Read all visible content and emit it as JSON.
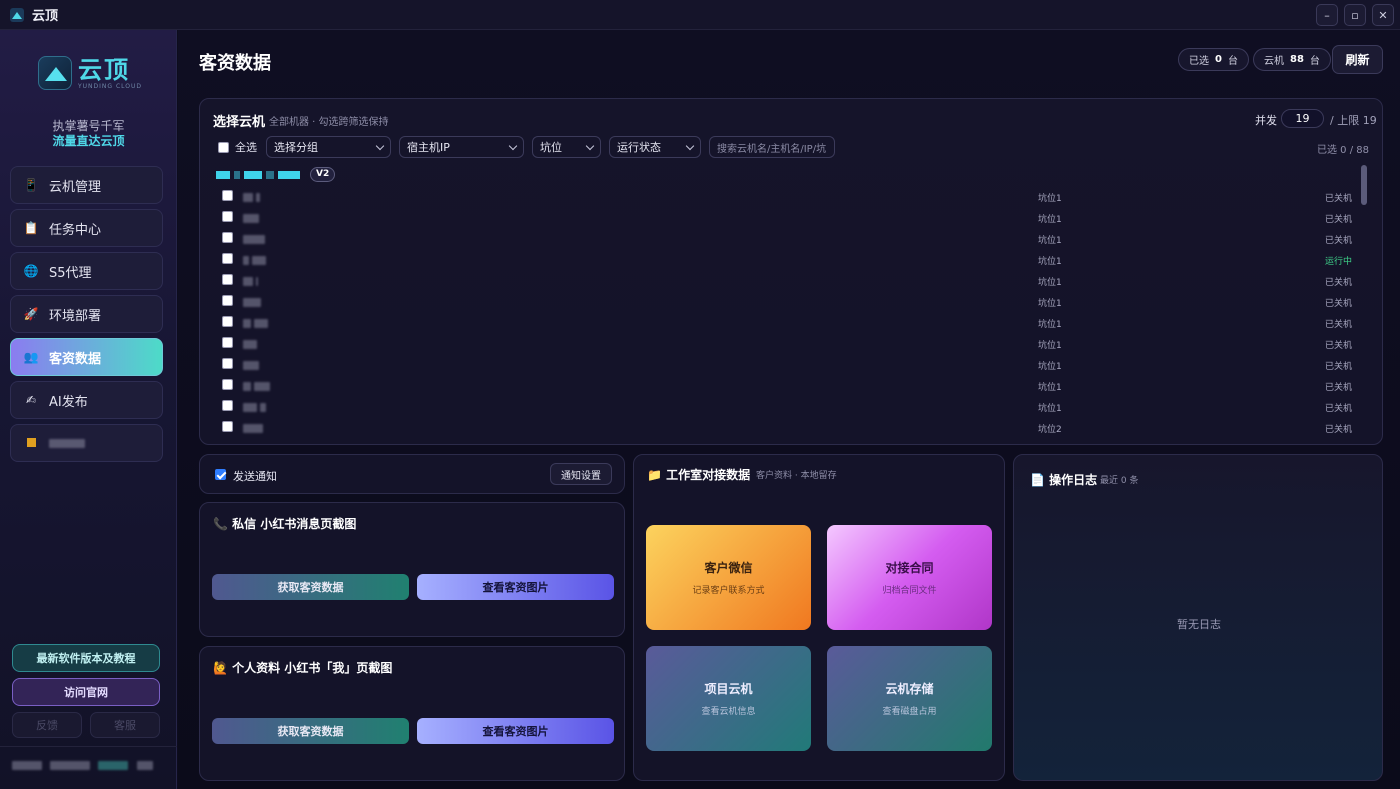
{
  "window": {
    "title": "云顶",
    "minimize": "–",
    "maximize": "▫",
    "close": "✕"
  },
  "sidebar": {
    "logo_cn": "云顶",
    "logo_en": "YUNDING CLOUD",
    "slogan_line1": "执掌薯号千军",
    "slogan_line2": "流量直达云顶",
    "items": [
      {
        "label": "云机管理",
        "icon": "phone-icon",
        "glyph": "📱"
      },
      {
        "label": "任务中心",
        "icon": "clipboard-icon",
        "glyph": "📋"
      },
      {
        "label": "S5代理",
        "icon": "globe-icon",
        "glyph": "🌐"
      },
      {
        "label": "环境部署",
        "icon": "rocket-icon",
        "glyph": "🚀"
      },
      {
        "label": "客资数据",
        "icon": "users-icon",
        "glyph": "👥",
        "active": true
      },
      {
        "label": "AI发布",
        "icon": "pen-icon",
        "glyph": "✍"
      }
    ],
    "version_btn": "最新软件版本及教程",
    "site_btn": "访问官网",
    "feedback_btn": "反馈",
    "service_btn": "客服"
  },
  "header": {
    "title": "客资数据",
    "selected_label": "已选",
    "selected_count": "0",
    "selected_unit": "台",
    "cloud_label": "云机",
    "cloud_count": "88",
    "cloud_unit": "台",
    "refresh": "刷新"
  },
  "machines": {
    "title": "选择云机",
    "subtitle": "全部机器 · 勾选跨筛选保持",
    "concurrency_label": "并发",
    "concurrency_value": "19",
    "concurrency_limit": "/ 上限 19",
    "select_all": "全选",
    "filters": {
      "group": "选择分组",
      "host_ip": "宿主机IP",
      "slot": "坑位",
      "status": "运行状态"
    },
    "search_placeholder": "搜索云机名/主机名/IP/坑",
    "selected_summary": "已选 0 / 88",
    "group_badge": "V2",
    "rows": [
      {
        "slot": "坑位1",
        "status": "已关机"
      },
      {
        "slot": "坑位1",
        "status": "已关机"
      },
      {
        "slot": "坑位1",
        "status": "已关机"
      },
      {
        "slot": "坑位1",
        "status": "运行中",
        "running": true
      },
      {
        "slot": "坑位1",
        "status": "已关机"
      },
      {
        "slot": "坑位1",
        "status": "已关机"
      },
      {
        "slot": "坑位1",
        "status": "已关机"
      },
      {
        "slot": "坑位1",
        "status": "已关机"
      },
      {
        "slot": "坑位1",
        "status": "已关机"
      },
      {
        "slot": "坑位1",
        "status": "已关机"
      },
      {
        "slot": "坑位1",
        "status": "已关机"
      },
      {
        "slot": "坑位2",
        "status": "已关机"
      }
    ]
  },
  "notify": {
    "label": "发送通知",
    "checked": true,
    "settings_btn": "通知设置"
  },
  "shot_private": {
    "icon": "📞",
    "title": "私信 小红书消息页截图",
    "get_btn": "获取客资数据",
    "view_btn": "查看客资图片"
  },
  "shot_profile": {
    "icon": "🙋",
    "title": "个人资料 小红书「我」页截图",
    "get_btn": "获取客资数据",
    "view_btn": "查看客资图片"
  },
  "studio": {
    "icon": "📁",
    "title": "工作室对接数据",
    "subtitle": "客户资料 · 本地留存",
    "cards": [
      {
        "title": "客户微信",
        "sub": "记录客户联系方式"
      },
      {
        "title": "对接合同",
        "sub": "归档合同文件"
      },
      {
        "title": "项目云机",
        "sub": "查看云机信息"
      },
      {
        "title": "云机存储",
        "sub": "查看磁盘占用"
      }
    ]
  },
  "log": {
    "icon": "📄",
    "title": "操作日志",
    "subtitle": "最近 0 条",
    "empty": "暂无日志"
  }
}
